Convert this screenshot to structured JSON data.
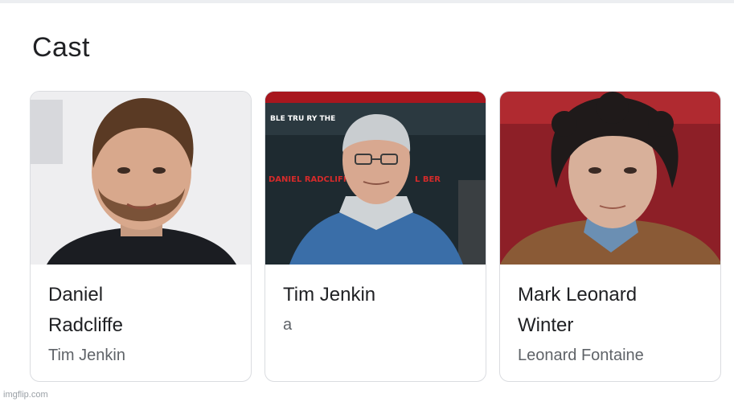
{
  "section": {
    "title": "Cast"
  },
  "cast": [
    {
      "name_line1": "Daniel",
      "name_line2": "Radcliffe",
      "role": "Tim Jenkin"
    },
    {
      "name_line1": "Tim Jenkin",
      "name_line2": "",
      "role": "a"
    },
    {
      "name_line1": "Mark Leonard",
      "name_line2": "Winter",
      "role": "Leonard Fontaine"
    }
  ],
  "poster_text": {
    "top": "BLE TRU     RY THE",
    "left": "DANIEL RADCLIFF",
    "right": "L BER"
  },
  "watermark": "imgflip.com",
  "colors": {
    "title": "#202124",
    "secondary": "#5f6368",
    "border": "#dadce0"
  }
}
